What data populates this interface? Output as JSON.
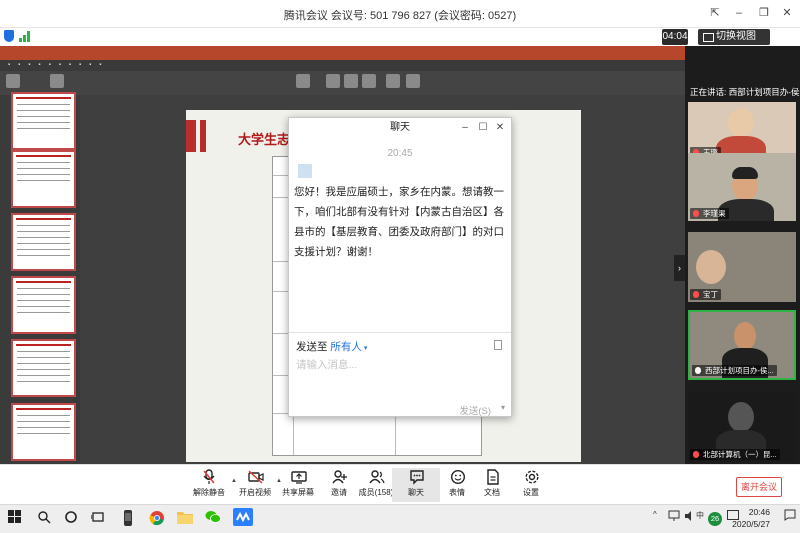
{
  "window": {
    "title": "腾讯会议 会议号: 501 796 827 (会议密码: 0527)"
  },
  "meeting": {
    "timer": "04:04",
    "switch_view_label": "切换视图"
  },
  "chat": {
    "title": "聊天",
    "time": "20:45",
    "message": "您好！我是应届硕士，家乡在内蒙。想请教一下，咱们北部有没有针对【内蒙古自治区】各县市的【基层教育、团委及政府部门】的对口支援计划？谢谢！",
    "send_to_prefix": "发送至",
    "send_to_target": "所有人",
    "input_placeholder": "请输入消息...",
    "send_label": "发送(S)"
  },
  "slide": {
    "title": "大学生志"
  },
  "participants": {
    "speaking_label": "正在讲话: 西部计划项目办-侯健",
    "tiles": [
      {
        "name": "王璐",
        "muted": true
      },
      {
        "name": "李瑾渠",
        "muted": true
      },
      {
        "name": "宝丁",
        "muted": true
      },
      {
        "name": "西部计划项目办-侯...",
        "muted": false
      },
      {
        "name": "北部计算机（一）昆...",
        "muted": true
      }
    ]
  },
  "toolbar": {
    "mute": "解除静音",
    "video": "开启视频",
    "share": "共享屏幕",
    "invite": "邀请",
    "members": "成员(158)",
    "chat": "聊天",
    "emoji": "表情",
    "docs": "文档",
    "settings": "设置",
    "leave": "离开会议"
  },
  "taskbar": {
    "time": "20:46",
    "date": "2020/5/27",
    "badge": "26"
  },
  "colors": {
    "accent_blue": "#1e6fe3",
    "leave_red": "#e04545",
    "slide_red": "#b82d2d"
  }
}
